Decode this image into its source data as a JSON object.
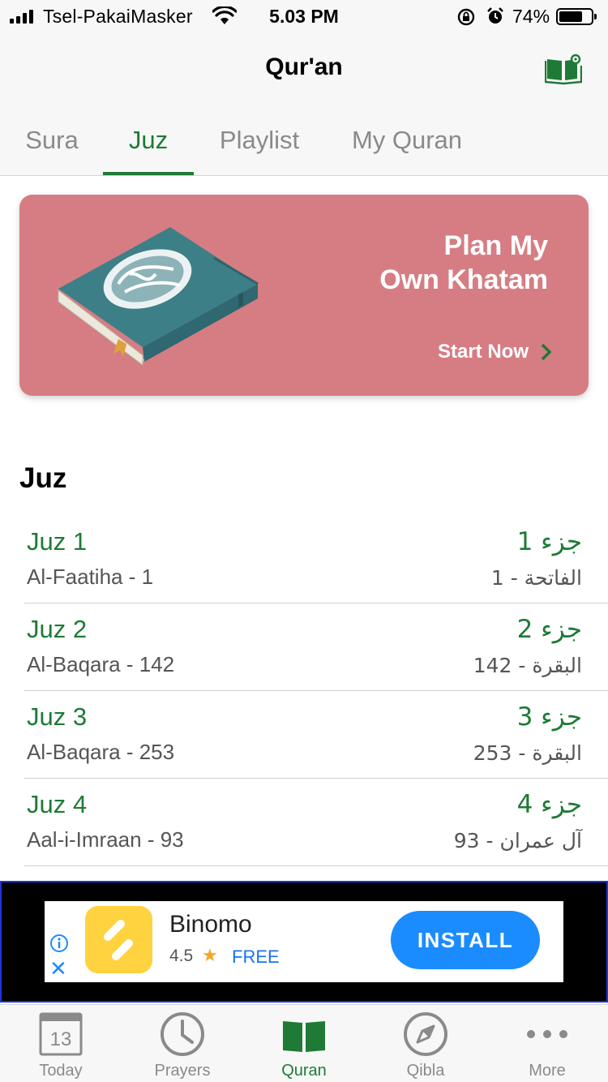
{
  "status_bar": {
    "carrier": "Tsel-PakaiMasker",
    "time": "5.03 PM",
    "battery_percent": "74%",
    "battery_level": 0.74
  },
  "nav": {
    "title": "Qur'an",
    "right_icon": "book-settings-icon"
  },
  "tabs": [
    {
      "label": "Sura",
      "active": false
    },
    {
      "label": "Juz",
      "active": true
    },
    {
      "label": "Playlist",
      "active": false
    },
    {
      "label": "My Quran",
      "active": false
    }
  ],
  "banner": {
    "title_line1": "Plan My",
    "title_line2": "Own Khatam",
    "cta": "Start Now",
    "background_color": "#d67d83"
  },
  "section_title": "Juz",
  "juz_list": [
    {
      "name": "Juz 1",
      "start": "Al-Faatiha - 1",
      "name_ar": "جزء 1",
      "start_ar": "الفاتحة - 1"
    },
    {
      "name": "Juz 2",
      "start": "Al-Baqara - 142",
      "name_ar": "جزء 2",
      "start_ar": "البقرة - 142"
    },
    {
      "name": "Juz 3",
      "start": "Al-Baqara - 253",
      "name_ar": "جزء 3",
      "start_ar": "البقرة - 253"
    },
    {
      "name": "Juz 4",
      "start": "Aal-i-Imraan - 93",
      "name_ar": "جزء 4",
      "start_ar": "آل عمران - 93"
    }
  ],
  "ad": {
    "app_name": "Binomo",
    "rating": "4.5",
    "price": "FREE",
    "install_label": "INSTALL"
  },
  "tab_bar": [
    {
      "label": "Today",
      "icon": "calendar-icon",
      "icon_text": "13",
      "active": false
    },
    {
      "label": "Prayers",
      "icon": "clock-icon",
      "active": false
    },
    {
      "label": "Quran",
      "icon": "quran-book-icon",
      "active": true
    },
    {
      "label": "Qibla",
      "icon": "compass-icon",
      "active": false
    },
    {
      "label": "More",
      "icon": "more-dots-icon",
      "active": false
    }
  ],
  "colors": {
    "accent_green": "#1e7a36",
    "inactive_gray": "#8a8a8a",
    "install_blue": "#1a8cff"
  }
}
